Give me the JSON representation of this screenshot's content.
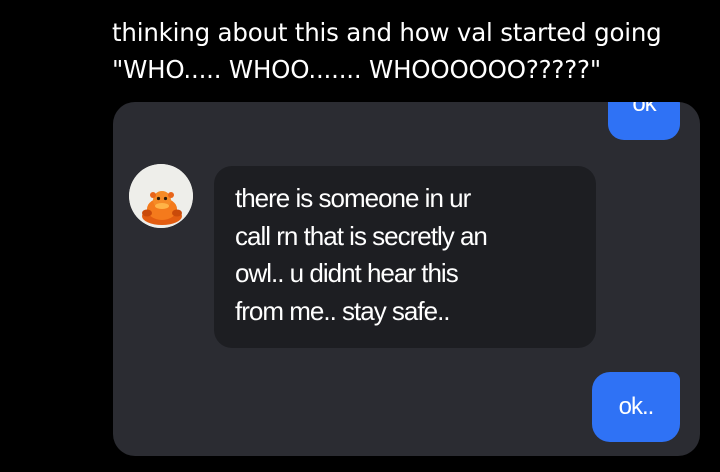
{
  "caption": {
    "line1": "thinking about this and how val started going",
    "line2": "\"WHO..... WHOO....... WHOOOOOO?????\""
  },
  "chat": {
    "top_outgoing": "ok",
    "incoming_lines": [
      "there is someone in ur",
      "call rn that is secretly an",
      "owl.. u didnt hear this",
      "from me.. stay safe.."
    ],
    "bottom_outgoing": "ok.."
  },
  "colors": {
    "page_background": "#000000",
    "chat_background": "#2b2c32",
    "incoming_bubble": "#1d1e22",
    "outgoing_bubble": "#2f72f5",
    "text": "#ffffff"
  },
  "icons": {
    "avatar": "orange-duck-avatar"
  }
}
